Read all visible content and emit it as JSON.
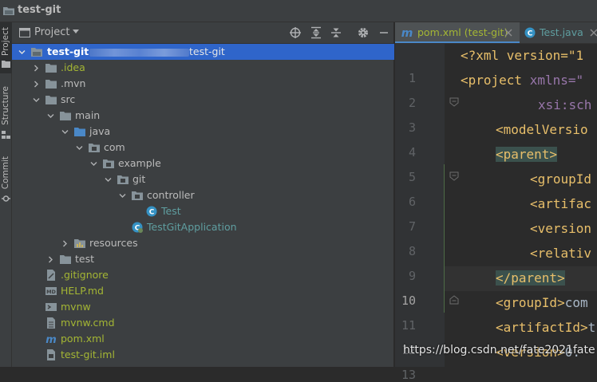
{
  "window": {
    "title": "test-git"
  },
  "sidebar_tabs": [
    {
      "label": "Project"
    },
    {
      "label": "Structure"
    },
    {
      "label": "Commit"
    }
  ],
  "project_panel": {
    "title": "Project",
    "toolbar_icons": [
      "locate-icon",
      "expand-all-icon",
      "collapse-all-icon",
      "gear-icon",
      "minimize-icon"
    ]
  },
  "tree": {
    "root_name": "test-git",
    "root_path": "test-git",
    "items": [
      {
        "label": ".idea"
      },
      {
        "label": ".mvn"
      },
      {
        "label": "src"
      },
      {
        "label": "main"
      },
      {
        "label": "java"
      },
      {
        "label": "com"
      },
      {
        "label": "example"
      },
      {
        "label": "git"
      },
      {
        "label": "controller"
      },
      {
        "label": "Test"
      },
      {
        "label": "TestGitApplication"
      },
      {
        "label": "resources"
      },
      {
        "label": "test"
      },
      {
        "label": ".gitignore"
      },
      {
        "label": "HELP.md"
      },
      {
        "label": "mvnw"
      },
      {
        "label": "mvnw.cmd"
      },
      {
        "label": "pom.xml"
      },
      {
        "label": "test-git.iml"
      }
    ]
  },
  "editor_tabs": [
    {
      "label": "pom.xml (test-git)"
    },
    {
      "label": "Test.java"
    }
  ],
  "line_numbers": [
    "1",
    "2",
    "3",
    "4",
    "5",
    "6",
    "7",
    "8",
    "9",
    "10",
    "11",
    "12",
    "13"
  ],
  "code": {
    "l1_pi": "<?xml version=\"1",
    "l2_tag": "<project",
    "l2_attr": " xmlns=\"",
    "l3_attr": "xsi:sch",
    "l4_tag": "<modelVersio",
    "l5_tag": "<parent>",
    "l6_tag": "<groupId",
    "l7_tag": "<artifac",
    "l8_tag": "<version",
    "l9_tag": "<relativ",
    "l10_tag": "</parent>",
    "l11_tag": "<groupId>",
    "l11_text": "com",
    "l12_tag": "<artifactId>",
    "l12_text": "t",
    "l13_tag": "<version>",
    "l13_text": "0."
  },
  "watermark": "https://blog.csdn.net/fate2021fate",
  "colors": {
    "selection": "#2f65ca",
    "tag": "#e8bf6a",
    "git_unversioned": "#a4b634",
    "java_new": "#5f9ea0"
  }
}
